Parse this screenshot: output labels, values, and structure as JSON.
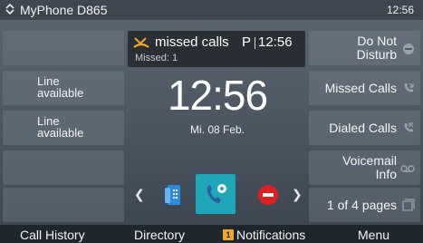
{
  "status_bar": {
    "device_name": "MyPhone D865",
    "time": "12:56"
  },
  "notification": {
    "title": "missed calls",
    "line_key": "P",
    "time": "12:56",
    "detail": "Missed: 1"
  },
  "clock": {
    "time": "12:56",
    "date": "Mi. 08 Feb."
  },
  "left_keys": [
    {
      "label_line1": "Line",
      "label_line2": "available"
    },
    {
      "label_line1": "Line",
      "label_line2": "available"
    },
    {
      "label_line1": "",
      "label_line2": ""
    },
    {
      "label_line1": "",
      "label_line2": ""
    },
    {
      "label_line1": "",
      "label_line2": ""
    }
  ],
  "right_keys": [
    {
      "line1": "Do Not",
      "line2": "Disturb",
      "icon": "dnd-icon"
    },
    {
      "line1": "Missed Calls",
      "icon": "missed-call-icon"
    },
    {
      "line1": "Dialed Calls",
      "icon": "dialed-call-icon"
    },
    {
      "line1": "Voicemail",
      "line2": "Info",
      "icon": "voicemail-icon"
    },
    {
      "line1": "1 of 4 pages",
      "icon": "pages-icon"
    }
  ],
  "softkeys": {
    "call_history": "Call History",
    "directory": "Directory",
    "notifications": "Notifications",
    "notifications_count": "1",
    "menu": "Menu"
  },
  "colors": {
    "accent_teal": "#1fa6b8",
    "warning_orange": "#f5a623",
    "dnd_red": "#e02020"
  }
}
